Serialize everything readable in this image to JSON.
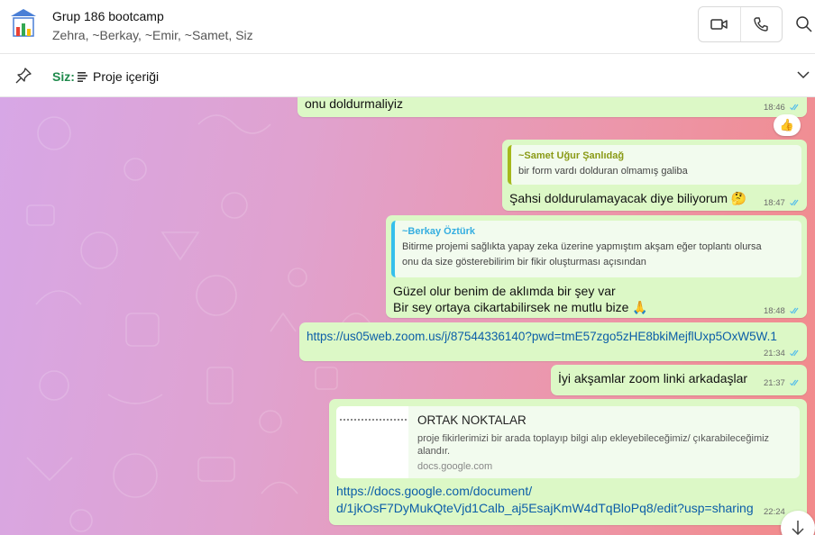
{
  "header": {
    "title": "Grup 186 bootcamp",
    "members": "Zehra, ~Berkay, ~Emir, ~Samet, Siz",
    "icons": {
      "video": "video-call-icon",
      "voice": "voice-call-icon",
      "search": "search-icon"
    }
  },
  "pinned": {
    "sender": "Siz:",
    "text": "Proje içeriği"
  },
  "messages": [
    {
      "text": "onu doldurmaliyiz",
      "time": "18:46",
      "reaction": "👍"
    },
    {
      "quote_author": "~Samet Uğur Şanlıdağ",
      "quote_author_color": "#8a9a16",
      "quote_text": "bir form vardı dolduran olmamış galiba",
      "text": "Şahsi doldurulamayacak diye biliyorum 🤔",
      "time": "18:47"
    },
    {
      "quote_author": "~Berkay Öztürk",
      "quote_author_color": "#35aee0",
      "quote_line1": "Bitirme projemi sağlıkta yapay zeka üzerine yapmıştım akşam eğer toplantı olursa",
      "quote_line2": "onu da size gösterebilirim bir fikir oluşturması açısından",
      "line1": "Güzel olur benim de aklımda bir şey var",
      "line2": "Bir sey ortaya cikartabilirsek ne mutlu bize 🙏",
      "time": "18:48"
    },
    {
      "link": "https://us05web.zoom.us/j/87544336140?pwd=tmE57zgo5zHE8bkiMejflUxp5OxW5W.1",
      "time": "21:34"
    },
    {
      "text": "İyi akşamlar zoom linki arkadaşlar",
      "time": "21:37"
    },
    {
      "preview_title": "ORTAK NOKTALAR",
      "preview_desc": "proje fikirlerimizi bir arada toplayıp bilgi alıp ekleyebileceğimiz/ çıkarabileceğimiz alandır.",
      "preview_domain": "docs.google.com",
      "link_line1": "https://docs.google.com/document/",
      "link_line2": "d/1jkOsF7DyMukQteVjd1Calb_aj5EsajKmW4dTqBloPq8/edit?usp=sharing",
      "time": "22:24"
    }
  ],
  "colors": {
    "bubble": "#dcf8c6",
    "link": "#0c5ea8",
    "tick": "#53bdeb",
    "accent": "#1f8a4c"
  }
}
